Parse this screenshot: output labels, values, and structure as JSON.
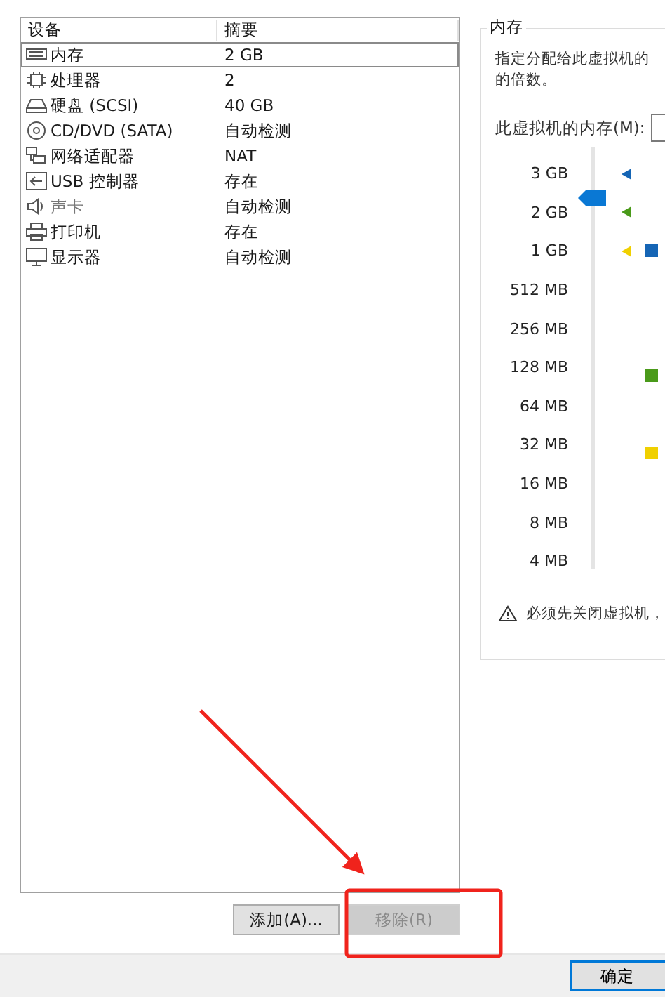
{
  "device_list": {
    "columns": [
      "设备",
      "摘要"
    ],
    "rows": [
      {
        "kind": "memory",
        "device": "内存",
        "summary": "2 GB",
        "selected": true
      },
      {
        "kind": "cpu",
        "device": "处理器",
        "summary": "2",
        "selected": false
      },
      {
        "kind": "disk",
        "device": "硬盘 (SCSI)",
        "summary": "40 GB",
        "selected": false
      },
      {
        "kind": "cd",
        "device": "CD/DVD (SATA)",
        "summary": "自动检测",
        "selected": false
      },
      {
        "kind": "network",
        "device": "网络适配器",
        "summary": "NAT",
        "selected": false
      },
      {
        "kind": "usb",
        "device": "USB 控制器",
        "summary": "存在",
        "selected": false
      },
      {
        "kind": "sound",
        "device": "声卡",
        "summary": "自动检测",
        "selected": false
      },
      {
        "kind": "printer",
        "device": "打印机",
        "summary": "存在",
        "selected": false
      },
      {
        "kind": "display",
        "device": "显示器",
        "summary": "自动检测",
        "selected": false
      }
    ]
  },
  "list_buttons": [
    {
      "label": "添加(A)...",
      "disabled": false
    },
    {
      "label": "移除(R)",
      "disabled": true
    }
  ],
  "memory_panel": {
    "title": "内存",
    "description": "指定分配给此虚拟机的",
    "description_2": "的倍数。",
    "memory_label": "此虚拟机的内存(M):",
    "slider": {
      "level": 0.9,
      "ticks": [
        {
          "label": "3 GB",
          "marker": {
            "color": "#1565b5"
          }
        },
        {
          "label": "2 GB",
          "marker": {
            "color": "#4a9a1a"
          }
        },
        {
          "label": "1 GB",
          "marker": {
            "color": "#f0d000"
          }
        },
        {
          "label": "512 MB"
        },
        {
          "label": "256 MB"
        },
        {
          "label": "128 MB"
        },
        {
          "label": "64 MB"
        },
        {
          "label": "32 MB"
        },
        {
          "label": "16 MB"
        },
        {
          "label": "8 MB"
        },
        {
          "label": "4 MB"
        }
      ]
    },
    "legend": [
      {
        "color": "#1565b5"
      },
      {
        "color": "#4a9a1a"
      },
      {
        "color": "#f0d000"
      }
    ],
    "warning": "必须先关闭虚拟机，"
  },
  "footer_buttons": [
    {
      "label": "确定",
      "default": true
    }
  ]
}
